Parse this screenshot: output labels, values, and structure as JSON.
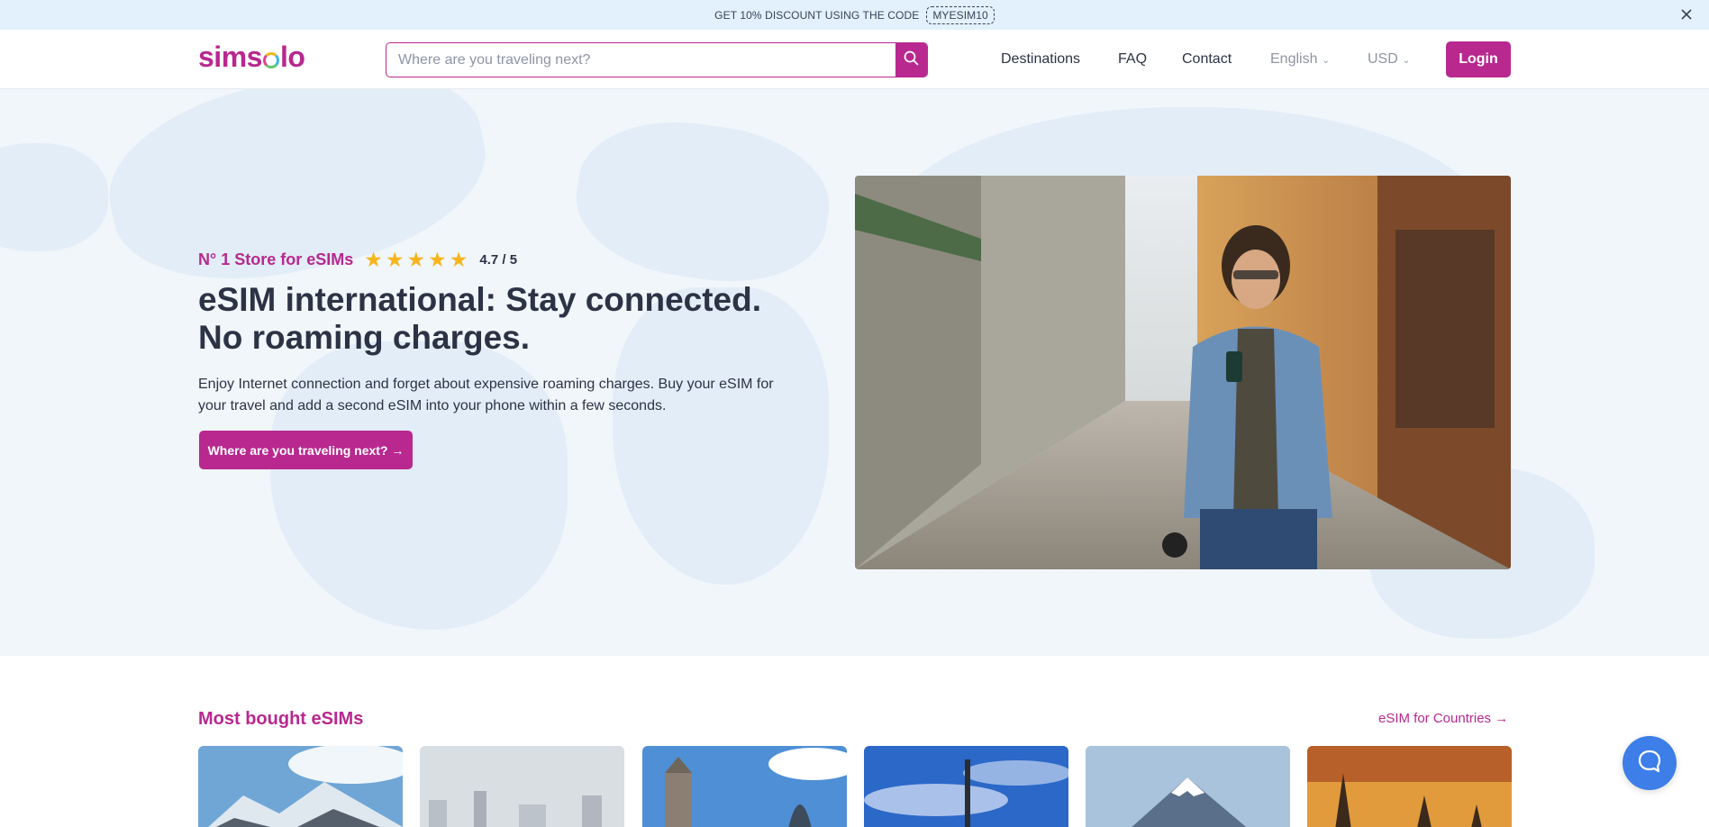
{
  "promo": {
    "text": "GET 10% DISCOUNT USING THE CODE",
    "code": "MYESIM10"
  },
  "header": {
    "logo": {
      "part1": "sims",
      "part2": "lo"
    },
    "search_placeholder": "Where are you traveling next?",
    "nav": {
      "destinations": "Destinations",
      "faq": "FAQ",
      "contact": "Contact",
      "language": "English",
      "currency": "USD"
    },
    "login": "Login"
  },
  "hero": {
    "store_label": "N° 1 Store for eSIMs",
    "star_count": 5,
    "score": "4.7 / 5",
    "title_line1": "eSIM international: Stay connected.",
    "title_line2": "No roaming charges.",
    "lead": "Enjoy Internet connection and forget about expensive roaming charges. Buy your eSIM for your travel and add a second eSIM into your phone within a few seconds.",
    "cta": "Where are you traveling next?  →"
  },
  "most_bought": {
    "title": "Most bought eSIMs",
    "link": "eSIM for Countries →",
    "cards": [
      "card-1",
      "card-2",
      "card-3",
      "card-4",
      "card-5",
      "card-6"
    ]
  },
  "colors": {
    "brand": "#b8288f",
    "promo_bg": "#e2f1fb",
    "hero_bg": "#f1f6fb",
    "chat": "#3d7ee8"
  }
}
